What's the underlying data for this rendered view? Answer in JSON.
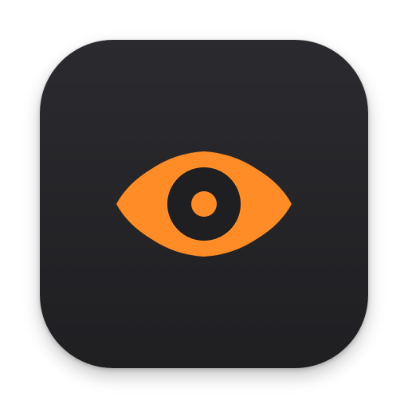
{
  "app_icon": {
    "name": "eye-app-icon",
    "background_color": "#242428",
    "accent_color": "#FF8C26",
    "glyph": "eye-icon"
  }
}
